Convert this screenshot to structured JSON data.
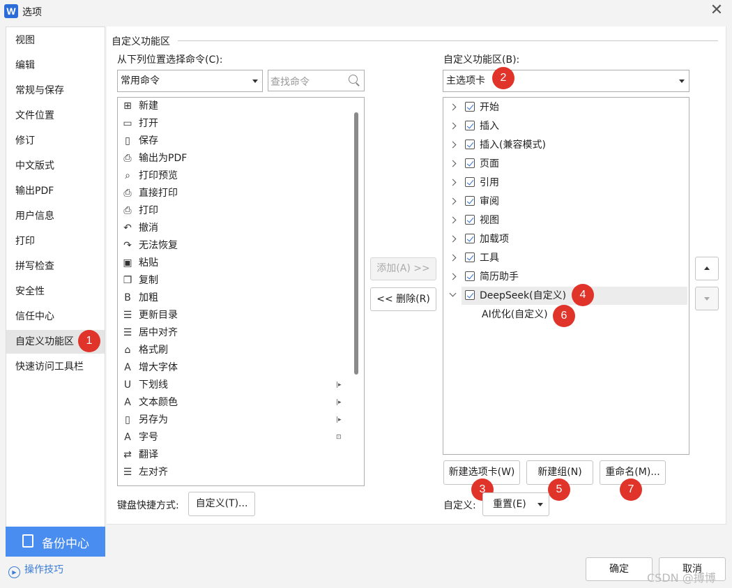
{
  "window": {
    "title": "选项",
    "app_icon": "W"
  },
  "sidebar": {
    "items": [
      "视图",
      "编辑",
      "常规与保存",
      "文件位置",
      "修订",
      "中文版式",
      "输出PDF",
      "用户信息",
      "打印",
      "拼写检查",
      "安全性",
      "信任中心",
      "自定义功能区",
      "快速访问工具栏"
    ],
    "active": "自定义功能区",
    "backup_label": "备份中心",
    "tips_label": "操作技巧"
  },
  "section": {
    "title": "自定义功能区",
    "choose_from_label": "从下列位置选择命令(C):",
    "choose_from_value": "常用命令",
    "search_placeholder": "查找命令",
    "customize_label": "自定义功能区(B):",
    "customize_value": "主选项卡"
  },
  "commands": [
    {
      "label": "新建",
      "icon": "new-icon",
      "glyph": "⊞"
    },
    {
      "label": "打开",
      "icon": "open-icon",
      "glyph": "▭"
    },
    {
      "label": "保存",
      "icon": "save-icon",
      "glyph": "▯"
    },
    {
      "label": "输出为PDF",
      "icon": "export-pdf-icon",
      "glyph": "⎙"
    },
    {
      "label": "打印预览",
      "icon": "print-preview-icon",
      "glyph": "⌕"
    },
    {
      "label": "直接打印",
      "icon": "direct-print-icon",
      "glyph": "⎙"
    },
    {
      "label": "打印",
      "icon": "print-icon",
      "glyph": "⎙"
    },
    {
      "label": "撤消",
      "icon": "undo-icon",
      "glyph": "↶"
    },
    {
      "label": "无法恢复",
      "icon": "redo-icon",
      "glyph": "↷"
    },
    {
      "label": "粘贴",
      "icon": "paste-icon",
      "glyph": "▣"
    },
    {
      "label": "复制",
      "icon": "copy-icon",
      "glyph": "❐"
    },
    {
      "label": "加粗",
      "icon": "bold-icon",
      "glyph": "B"
    },
    {
      "label": "更新目录",
      "icon": "update-toc-icon",
      "glyph": "☰"
    },
    {
      "label": "居中对齐",
      "icon": "align-center-icon",
      "glyph": "☰"
    },
    {
      "label": "格式刷",
      "icon": "format-painter-icon",
      "glyph": "⌂"
    },
    {
      "label": "增大字体",
      "icon": "grow-font-icon",
      "glyph": "A"
    },
    {
      "label": "下划线",
      "icon": "underline-icon",
      "glyph": "U",
      "sub": "|▸"
    },
    {
      "label": "文本颜色",
      "icon": "text-color-icon",
      "glyph": "A",
      "sub": "|▸"
    },
    {
      "label": "另存为",
      "icon": "save-as-icon",
      "glyph": "▯",
      "sub": "|▸"
    },
    {
      "label": "字号",
      "icon": "font-size-icon",
      "glyph": "A",
      "sub": "⊡"
    },
    {
      "label": "翻译",
      "icon": "translate-icon",
      "glyph": "⇄"
    },
    {
      "label": "左对齐",
      "icon": "align-left-icon",
      "glyph": "☰"
    }
  ],
  "buttons": {
    "add": "添加(A) >>",
    "remove": "<< 删除(R)",
    "new_tab": "新建选项卡(W)",
    "new_group": "新建组(N)",
    "rename": "重命名(M)...",
    "keyboard_label": "键盘快捷方式:",
    "keyboard_btn": "自定义(T)...",
    "customize_label": "自定义:",
    "reset": "重置(E)",
    "ok": "确定",
    "cancel": "取消"
  },
  "tree": [
    {
      "label": "开始"
    },
    {
      "label": "插入"
    },
    {
      "label": "插入(兼容模式)"
    },
    {
      "label": "页面"
    },
    {
      "label": "引用"
    },
    {
      "label": "审阅"
    },
    {
      "label": "视图"
    },
    {
      "label": "加载项"
    },
    {
      "label": "工具"
    },
    {
      "label": "简历助手"
    },
    {
      "label": "DeepSeek(自定义)"
    }
  ],
  "tree_child": "AI优化(自定义)",
  "badges": [
    "1",
    "2",
    "3",
    "4",
    "5",
    "6",
    "7"
  ],
  "watermark": "CSDN @搏博",
  "colors": {
    "accent": "#4a8df0",
    "badge": "#e0342b"
  }
}
